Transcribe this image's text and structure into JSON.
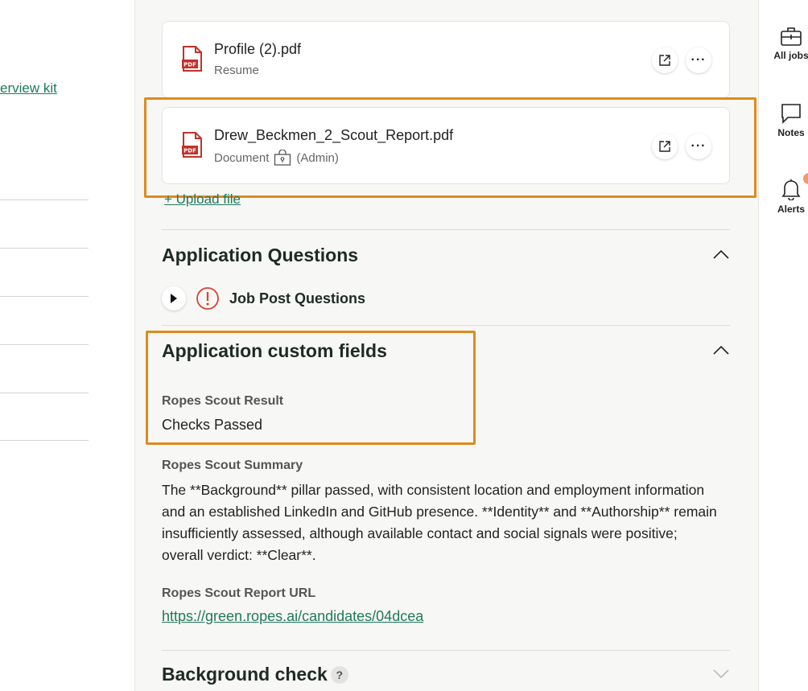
{
  "left": {
    "kit_link": "erview kit"
  },
  "attachments": [
    {
      "name": "Profile (2).pdf",
      "type": "Resume",
      "admin_only": false
    },
    {
      "name": "Drew_Beckmen_2_Scout_Report.pdf",
      "type": "Document",
      "admin_label": "(Admin)",
      "admin_only": true
    }
  ],
  "upload_link": "+ Upload file",
  "application_questions": {
    "title": "Application Questions",
    "job_post_questions": "Job Post Questions"
  },
  "custom_fields": {
    "title": "Application custom fields",
    "result_label": "Ropes Scout Result",
    "result_value": "Checks Passed",
    "summary_label": "Ropes Scout Summary",
    "summary_value": "The **Background** pillar passed, with consistent location and employment information and an established LinkedIn and GitHub presence. **Identity** and **Authorship** remain insufficiently assessed, although available contact and social signals were positive; overall verdict: **Clear**.",
    "url_label": "Ropes Scout Report URL",
    "url_value": "https://green.ropes.ai/candidates/04dcea"
  },
  "background_check": {
    "title": "Background check",
    "help": "?"
  },
  "rail": {
    "items": [
      {
        "label": "All jobs",
        "icon": "briefcase-icon"
      },
      {
        "label": "Notes",
        "icon": "comment-icon"
      },
      {
        "label": "Alerts",
        "icon": "bell-icon"
      }
    ]
  },
  "colors": {
    "accent_link": "#1f7a5b",
    "highlight": "#e08a1e",
    "pdf_red": "#c0322b",
    "warning_red": "#d64533",
    "alert_dot": "#f29a6b"
  }
}
